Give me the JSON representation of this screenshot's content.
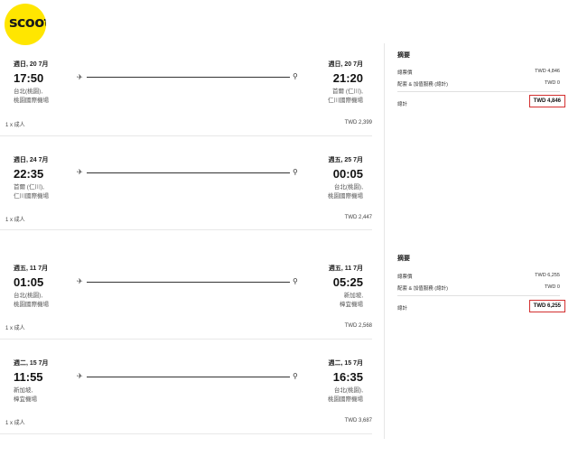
{
  "brand": {
    "logo_text": "scoot",
    "color": "#ffe600"
  },
  "bookings": [
    {
      "legs": [
        {
          "dep_date": "週日, 20 7月",
          "dep_time": "17:50",
          "dep_place": [
            "台北(桃園),",
            "桃園國際機場"
          ],
          "arr_date": "週日, 20 7月",
          "arr_time": "21:20",
          "arr_place": [
            "首爾 (仁川),",
            "仁川國際機場"
          ],
          "pax": "1 x 成人",
          "price": "TWD 2,399"
        },
        {
          "dep_date": "週日, 24 7月",
          "dep_time": "22:35",
          "dep_place": [
            "首爾 (仁川),",
            "仁川國際機場"
          ],
          "arr_date": "週五, 25 7月",
          "arr_time": "00:05",
          "arr_place": [
            "台北(桃園),",
            "桃園國際機場"
          ],
          "pax": "1 x 成人",
          "price": "TWD 2,447"
        }
      ],
      "summary": {
        "title": "摘要",
        "fare_label": "總票價",
        "fare_value": "TWD 4,846",
        "addons_label": "配套 & 加值服務 (總計)",
        "addons_value": "TWD 0",
        "total_label": "總計",
        "total_value": "TWD 4,846"
      }
    },
    {
      "legs": [
        {
          "dep_date": "週五, 11 7月",
          "dep_time": "01:05",
          "dep_place": [
            "台北(桃園),",
            "桃園國際機場"
          ],
          "arr_date": "週五, 11 7月",
          "arr_time": "05:25",
          "arr_place": [
            "新加坡,",
            "樟宜機場"
          ],
          "pax": "1 x 成人",
          "price": "TWD 2,568"
        },
        {
          "dep_date": "週二, 15 7月",
          "dep_time": "11:55",
          "dep_place": [
            "新加坡,",
            "樟宜機場"
          ],
          "arr_date": "週二, 15 7月",
          "arr_time": "16:35",
          "arr_place": [
            "台北(桃園),",
            "桃園國際機場"
          ],
          "pax": "1 x 成人",
          "price": "TWD 3,687"
        }
      ],
      "summary": {
        "title": "摘要",
        "fare_label": "總票價",
        "fare_value": "TWD 6,255",
        "addons_label": "配套 & 加值服務 (總計)",
        "addons_value": "TWD 0",
        "total_label": "總計",
        "total_value": "TWD 6,255"
      }
    }
  ],
  "icons": {
    "departure": "plane-icon",
    "arrival": "location-pin-icon"
  },
  "colors": {
    "highlight_box": "#d32f2f"
  }
}
